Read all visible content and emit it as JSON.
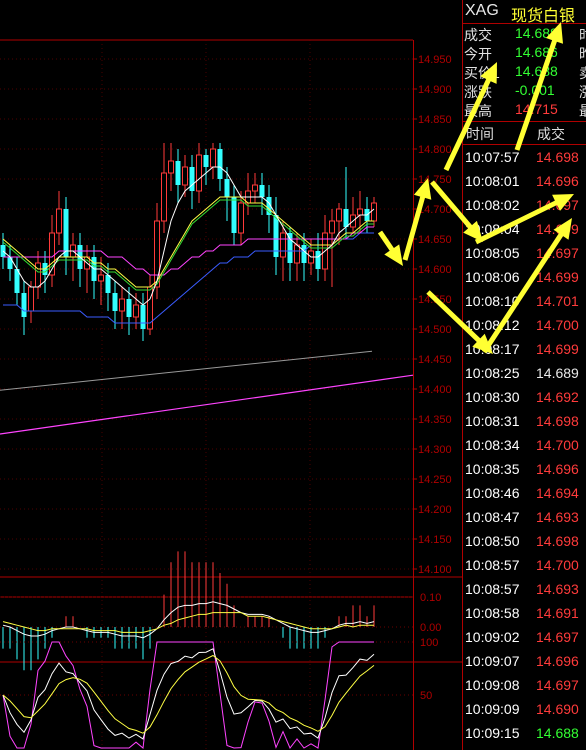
{
  "header": {
    "code": "XAG",
    "name": "现货白银"
  },
  "quote": [
    {
      "label": "成交",
      "value": "14.688",
      "color": "green",
      "cut": "时"
    },
    {
      "label": "今开",
      "value": "14.686",
      "color": "green",
      "cut": "昨"
    },
    {
      "label": "买价1",
      "value": "14.688",
      "color": "green",
      "cut": "卖"
    },
    {
      "label": "涨跌",
      "value": "-0.001",
      "color": "green",
      "cut": "涨"
    },
    {
      "label": "最高",
      "value": "14.715",
      "color": "red",
      "cut": "最"
    }
  ],
  "trades_header": {
    "time": "时间",
    "price": "成交"
  },
  "trades": [
    {
      "time": "10:07:57",
      "price": "14.698",
      "color": "red"
    },
    {
      "time": "10:08:01",
      "price": "14.696",
      "color": "red"
    },
    {
      "time": "10:08:02",
      "price": "14.697",
      "color": "red"
    },
    {
      "time": "10:08:04",
      "price": "14.699",
      "color": "red"
    },
    {
      "time": "10:08:05",
      "price": "14.697",
      "color": "red"
    },
    {
      "time": "10:08:06",
      "price": "14.699",
      "color": "red"
    },
    {
      "time": "10:08:10",
      "price": "14.701",
      "color": "red"
    },
    {
      "time": "10:08:12",
      "price": "14.700",
      "color": "red"
    },
    {
      "time": "10:08:17",
      "price": "14.699",
      "color": "red"
    },
    {
      "time": "10:08:25",
      "price": "14.689",
      "color": "white"
    },
    {
      "time": "10:08:30",
      "price": "14.692",
      "color": "red"
    },
    {
      "time": "10:08:31",
      "price": "14.698",
      "color": "red"
    },
    {
      "time": "10:08:34",
      "price": "14.700",
      "color": "red"
    },
    {
      "time": "10:08:35",
      "price": "14.696",
      "color": "red"
    },
    {
      "time": "10:08:46",
      "price": "14.694",
      "color": "red"
    },
    {
      "time": "10:08:47",
      "price": "14.693",
      "color": "red"
    },
    {
      "time": "10:08:50",
      "price": "14.698",
      "color": "red"
    },
    {
      "time": "10:08:57",
      "price": "14.700",
      "color": "red"
    },
    {
      "time": "10:08:57",
      "price": "14.693",
      "color": "red"
    },
    {
      "time": "10:08:58",
      "price": "14.691",
      "color": "red"
    },
    {
      "time": "10:09:02",
      "price": "14.697",
      "color": "red"
    },
    {
      "time": "10:09:07",
      "price": "14.696",
      "color": "red"
    },
    {
      "time": "10:09:08",
      "price": "14.697",
      "color": "red"
    },
    {
      "time": "10:09:09",
      "price": "14.690",
      "color": "red"
    },
    {
      "time": "10:09:15",
      "price": "14.688",
      "color": "green"
    }
  ],
  "main_axis": {
    "ticks": [
      "14.950",
      "14.900",
      "14.850",
      "14.800",
      "14.750",
      "14.700",
      "14.650",
      "14.600",
      "14.550",
      "14.500",
      "14.450",
      "14.400",
      "14.350",
      "14.300",
      "14.250",
      "14.200",
      "14.150",
      "14.100"
    ]
  },
  "macd_axis": {
    "ticks": [
      "0.10",
      "0.00"
    ]
  },
  "kdj_axis": {
    "ticks": [
      "100",
      "50"
    ]
  },
  "candles": [
    [
      14.64,
      14.62,
      14.66,
      14.6
    ],
    [
      14.62,
      14.6,
      14.64,
      14.58
    ],
    [
      14.6,
      14.56,
      14.62,
      14.54
    ],
    [
      14.56,
      14.52,
      14.58,
      14.49
    ],
    [
      14.53,
      14.57,
      14.58,
      14.51
    ],
    [
      14.57,
      14.61,
      14.63,
      14.55
    ],
    [
      14.61,
      14.59,
      14.63,
      14.56
    ],
    [
      14.59,
      14.66,
      14.69,
      14.57
    ],
    [
      14.66,
      14.7,
      14.73,
      14.64
    ],
    [
      14.7,
      14.62,
      14.72,
      14.59
    ],
    [
      14.62,
      14.64,
      14.66,
      14.58
    ],
    [
      14.64,
      14.6,
      14.66,
      14.57
    ],
    [
      14.6,
      14.62,
      14.64,
      14.56
    ],
    [
      14.62,
      14.58,
      14.64,
      14.55
    ],
    [
      14.58,
      14.59,
      14.62,
      14.54
    ],
    [
      14.59,
      14.56,
      14.61,
      14.53
    ],
    [
      14.56,
      14.53,
      14.58,
      14.5
    ],
    [
      14.53,
      14.55,
      14.57,
      14.5
    ],
    [
      14.55,
      14.52,
      14.57,
      14.49
    ],
    [
      14.52,
      14.54,
      14.56,
      14.5
    ],
    [
      14.54,
      14.5,
      14.56,
      14.48
    ],
    [
      14.5,
      14.57,
      14.59,
      14.49
    ],
    [
      14.57,
      14.68,
      14.71,
      14.55
    ],
    [
      14.68,
      14.76,
      14.81,
      14.66
    ],
    [
      14.76,
      14.78,
      14.81,
      14.73
    ],
    [
      14.78,
      14.74,
      14.8,
      14.71
    ],
    [
      14.74,
      14.77,
      14.79,
      14.72
    ],
    [
      14.77,
      14.73,
      14.79,
      14.7
    ],
    [
      14.73,
      14.79,
      14.81,
      14.71
    ],
    [
      14.79,
      14.77,
      14.8,
      14.74
    ],
    [
      14.77,
      14.8,
      14.81,
      14.75
    ],
    [
      14.8,
      14.75,
      14.81,
      14.73
    ],
    [
      14.75,
      14.72,
      14.77,
      14.68
    ],
    [
      14.72,
      14.66,
      14.74,
      14.64
    ],
    [
      14.66,
      14.71,
      14.73,
      14.64
    ],
    [
      14.71,
      14.73,
      14.76,
      14.69
    ],
    [
      14.73,
      14.74,
      14.76,
      14.71
    ],
    [
      14.74,
      14.72,
      14.76,
      14.69
    ],
    [
      14.72,
      14.69,
      14.74,
      14.66
    ],
    [
      14.69,
      14.62,
      14.72,
      14.59
    ],
    [
      14.62,
      14.66,
      14.68,
      14.58
    ],
    [
      14.66,
      14.61,
      14.67,
      14.58
    ],
    [
      14.61,
      14.64,
      14.66,
      14.58
    ],
    [
      14.64,
      14.61,
      14.66,
      14.58
    ],
    [
      14.61,
      14.63,
      14.65,
      14.59
    ],
    [
      14.63,
      14.6,
      14.66,
      14.58
    ],
    [
      14.6,
      14.66,
      14.69,
      14.58
    ],
    [
      14.66,
      14.68,
      14.7,
      14.57
    ],
    [
      14.68,
      14.7,
      14.71,
      14.64
    ],
    [
      14.7,
      14.67,
      14.77,
      14.65
    ],
    [
      14.67,
      14.69,
      14.72,
      14.66
    ],
    [
      14.69,
      14.7,
      14.73,
      14.66
    ],
    [
      14.7,
      14.68,
      14.72,
      14.66
    ],
    [
      14.68,
      14.71,
      14.72,
      14.67
    ]
  ],
  "ma_fast": [
    14.63,
    14.62,
    14.6,
    14.58,
    14.57,
    14.57,
    14.58,
    14.6,
    14.62,
    14.63,
    14.63,
    14.62,
    14.61,
    14.6,
    14.6,
    14.59,
    14.58,
    14.57,
    14.56,
    14.55,
    14.54,
    14.55,
    14.58,
    14.63,
    14.68,
    14.71,
    14.73,
    14.74,
    14.75,
    14.76,
    14.77,
    14.77,
    14.76,
    14.74,
    14.72,
    14.72,
    14.72,
    14.72,
    14.71,
    14.69,
    14.67,
    14.65,
    14.64,
    14.63,
    14.62,
    14.62,
    14.63,
    14.64,
    14.66,
    14.67,
    14.68,
    14.69,
    14.69,
    14.7
  ],
  "ma_mid": [
    14.65,
    14.64,
    14.63,
    14.62,
    14.61,
    14.6,
    14.6,
    14.61,
    14.62,
    14.62,
    14.62,
    14.62,
    14.62,
    14.61,
    14.61,
    14.6,
    14.6,
    14.59,
    14.58,
    14.57,
    14.57,
    14.57,
    14.58,
    14.6,
    14.62,
    14.64,
    14.66,
    14.68,
    14.69,
    14.7,
    14.71,
    14.72,
    14.72,
    14.72,
    14.72,
    14.71,
    14.71,
    14.71,
    14.7,
    14.69,
    14.68,
    14.67,
    14.66,
    14.65,
    14.64,
    14.64,
    14.64,
    14.64,
    14.65,
    14.66,
    14.66,
    14.67,
    14.68,
    14.68
  ],
  "ma_slow": [
    14.62,
    14.62,
    14.62,
    14.62,
    14.62,
    14.62,
    14.62,
    14.62,
    14.63,
    14.63,
    14.63,
    14.63,
    14.63,
    14.63,
    14.63,
    14.62,
    14.62,
    14.62,
    14.61,
    14.6,
    14.6,
    14.59,
    14.59,
    14.59,
    14.6,
    14.6,
    14.61,
    14.62,
    14.62,
    14.63,
    14.63,
    14.64,
    14.64,
    14.64,
    14.64,
    14.65,
    14.65,
    14.65,
    14.65,
    14.65,
    14.65,
    14.65,
    14.65,
    14.65,
    14.65,
    14.65,
    14.65,
    14.65,
    14.65,
    14.65,
    14.66,
    14.66,
    14.67,
    14.67
  ],
  "ma_base": [
    14.54,
    14.54,
    14.54,
    14.53,
    14.53,
    14.53,
    14.53,
    14.53,
    14.53,
    14.53,
    14.53,
    14.53,
    14.52,
    14.52,
    14.52,
    14.52,
    14.51,
    14.51,
    14.51,
    14.51,
    14.51,
    14.51,
    14.52,
    14.53,
    14.54,
    14.55,
    14.56,
    14.57,
    14.58,
    14.59,
    14.6,
    14.61,
    14.61,
    14.62,
    14.62,
    14.62,
    14.63,
    14.63,
    14.63,
    14.63,
    14.63,
    14.63,
    14.63,
    14.63,
    14.64,
    14.64,
    14.64,
    14.64,
    14.65,
    14.65,
    14.65,
    14.66,
    14.66,
    14.66
  ],
  "ma_long": {
    "from": 14.398,
    "to": 14.463
  },
  "ma_longest": {
    "from": 14.325,
    "to": 14.423
  },
  "colors": {
    "up": "#ff3a3a",
    "down": "#33ffff",
    "axis": "#b00000",
    "grid": "#6a0000",
    "ma_fast": "#ffffff",
    "ma_mid": "#ffff44",
    "ma_slow": "#ff44ff",
    "ma_base": "#33dd33",
    "ma_blue": "#3a5cff",
    "ma_long": "#999999",
    "ma_longest": "#ff44ff",
    "arrow": "#ffff33"
  }
}
